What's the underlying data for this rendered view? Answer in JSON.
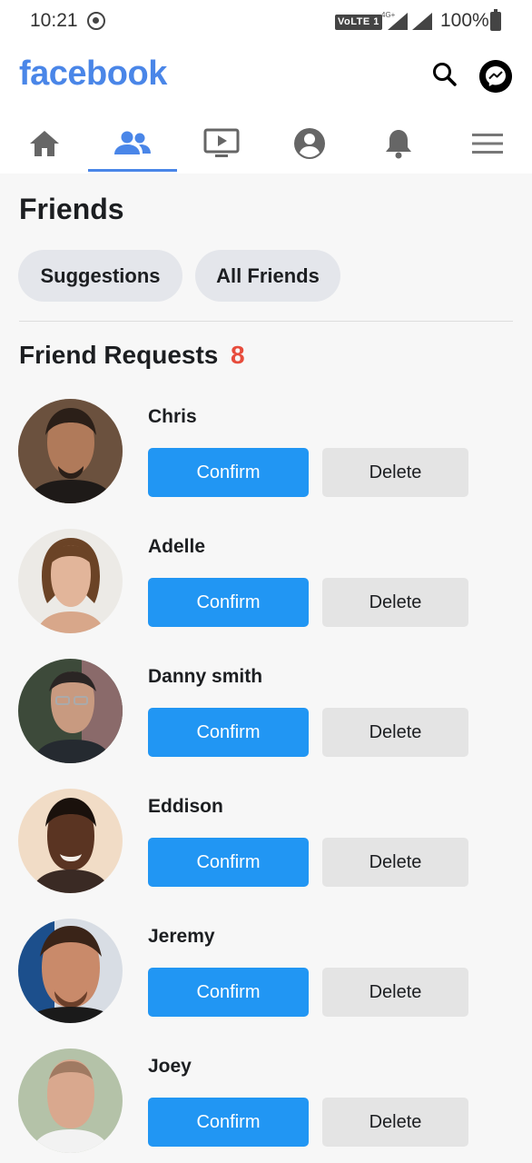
{
  "status_bar": {
    "time": "10:21",
    "volte": "VoLTE 1",
    "network": "4G+",
    "battery": "100%"
  },
  "header": {
    "logo": "facebook",
    "icons": [
      "search-icon",
      "messenger-icon"
    ]
  },
  "nav": {
    "tabs": [
      {
        "name": "home",
        "icon": "home-icon"
      },
      {
        "name": "friends",
        "icon": "friends-icon",
        "active": true
      },
      {
        "name": "watch",
        "icon": "video-icon"
      },
      {
        "name": "profile",
        "icon": "profile-icon"
      },
      {
        "name": "notifications",
        "icon": "bell-icon"
      },
      {
        "name": "menu",
        "icon": "menu-icon"
      }
    ]
  },
  "page": {
    "title": "Friends",
    "pills": [
      "Suggestions",
      "All Friends"
    ],
    "section_title": "Friend Requests",
    "request_count": "8"
  },
  "requests": [
    {
      "name": "Chris",
      "confirm": "Confirm",
      "delete": "Delete"
    },
    {
      "name": "Adelle",
      "confirm": "Confirm",
      "delete": "Delete"
    },
    {
      "name": "Danny smith",
      "confirm": "Confirm",
      "delete": "Delete"
    },
    {
      "name": "Eddison",
      "confirm": "Confirm",
      "delete": "Delete"
    },
    {
      "name": "Jeremy",
      "confirm": "Confirm",
      "delete": "Delete"
    },
    {
      "name": "Joey",
      "confirm": "Confirm",
      "delete": "Delete"
    }
  ],
  "colors": {
    "brand": "#4a86e8",
    "confirm": "#2196f3",
    "count": "#e74c3c",
    "pill": "#e4e6eb"
  }
}
